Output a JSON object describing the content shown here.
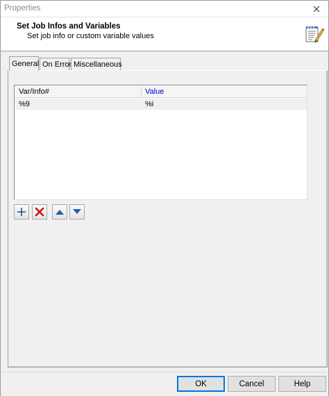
{
  "window": {
    "title": "Properties"
  },
  "header": {
    "title": "Set Job Infos and Variables",
    "subtitle": "Set job info or custom variable values",
    "icon": "notepad-pencil-icon"
  },
  "tabs": [
    {
      "label": "General",
      "active": true
    },
    {
      "label": "On Error",
      "active": false
    },
    {
      "label": "Miscellaneous",
      "active": false
    }
  ],
  "grid": {
    "columns": [
      "Var/Info#",
      "Value"
    ],
    "rows": [
      [
        "%9",
        "%i"
      ]
    ]
  },
  "toolbar": {
    "add_icon": "plus-icon",
    "delete_icon": "red-x-icon",
    "up_icon": "arrow-up-icon",
    "down_icon": "arrow-down-icon"
  },
  "buttons": {
    "ok": "OK",
    "cancel": "Cancel",
    "help": "Help"
  },
  "colors": {
    "value_header": "#0000cc",
    "delete_red": "#d01010",
    "arrow_blue": "#1f5fa8",
    "add_blue": "#1a4f8a"
  }
}
